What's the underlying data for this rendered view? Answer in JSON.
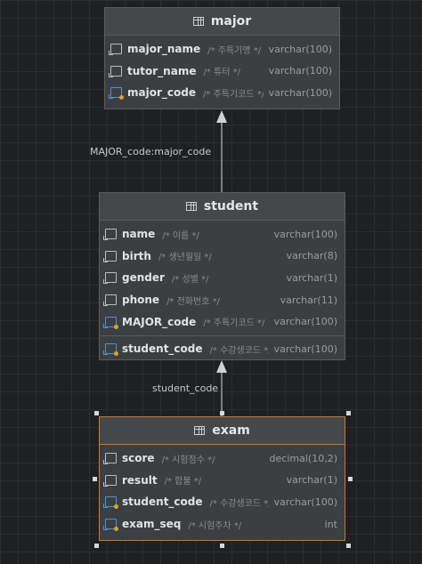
{
  "relations": [
    {
      "label": "MAJOR_code:major_code"
    },
    {
      "label": "student_code"
    }
  ],
  "tables": {
    "major": {
      "title": "major",
      "columns": [
        {
          "name": "major_name",
          "comment": "/* 주특기명 */",
          "type": "varchar(100)",
          "icon": "column-icon"
        },
        {
          "name": "tutor_name",
          "comment": "/* 튜터 */",
          "type": "varchar(100)",
          "icon": "column-icon"
        },
        {
          "name": "major_code",
          "comment": "/* 주특기코드 */",
          "type": "varchar(100)",
          "icon": "key-column-icon"
        }
      ]
    },
    "student": {
      "title": "student",
      "columns": [
        {
          "name": "name",
          "comment": "/* 이름 */",
          "type": "varchar(100)",
          "icon": "column-icon"
        },
        {
          "name": "birth",
          "comment": "/* 생년월일 */",
          "type": "varchar(8)",
          "icon": "column-icon"
        },
        {
          "name": "gender",
          "comment": "/* 성별 */",
          "type": "varchar(1)",
          "icon": "column-icon"
        },
        {
          "name": "phone",
          "comment": "/* 전화번호 */",
          "type": "varchar(11)",
          "icon": "column-icon"
        },
        {
          "name": "MAJOR_code",
          "comment": "/* 주특기코드 */",
          "type": "varchar(100)",
          "icon": "foreign-key-column-icon"
        }
      ],
      "key_columns": [
        {
          "name": "student_code",
          "comment": "/* 수강생코드 */",
          "type": "varchar(100)",
          "icon": "key-column-icon"
        }
      ]
    },
    "exam": {
      "title": "exam",
      "columns": [
        {
          "name": "score",
          "comment": "/* 시험점수 */",
          "type": "decimal(10,2)",
          "icon": "column-icon"
        },
        {
          "name": "result",
          "comment": "/* 합불 */",
          "type": "varchar(1)",
          "icon": "column-icon"
        },
        {
          "name": "student_code",
          "comment": "/* 수강생코드 */",
          "type": "varchar(100)",
          "icon": "foreign-key-column-icon"
        },
        {
          "name": "exam_seq",
          "comment": "/* 시험주차 */",
          "type": "int",
          "icon": "key-column-icon"
        }
      ]
    }
  },
  "colors": {
    "background": "#1f2022",
    "table": "#3c3f41",
    "selected_border": "#c77a2a",
    "connector": "#b0b0b0"
  }
}
